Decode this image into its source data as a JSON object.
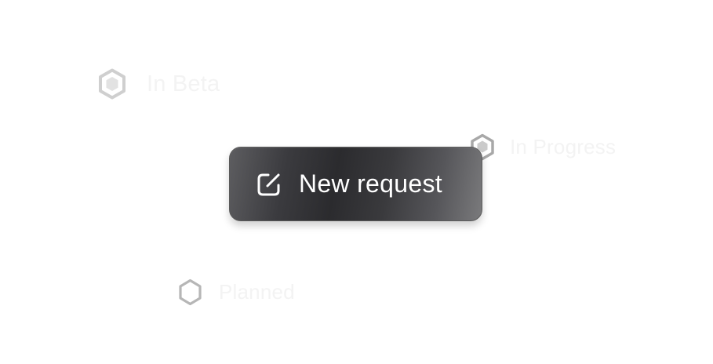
{
  "statuses": {
    "beta": {
      "label": "In Beta",
      "icon": "hexagon-filled-icon"
    },
    "in_progress": {
      "label": "In Progress",
      "icon": "hexagon-filled-icon"
    },
    "planned": {
      "label": "Planned",
      "icon": "hexagon-outline-icon"
    }
  },
  "new_request": {
    "label": "New request",
    "icon": "edit-square-icon"
  },
  "colors": {
    "hex_stroke": "#c6c6c6",
    "hex_fill": "#e4e4e4",
    "faded_label": "#f3f3f3",
    "button_dark": "#2b2b2e",
    "button_text": "#ffffff"
  }
}
